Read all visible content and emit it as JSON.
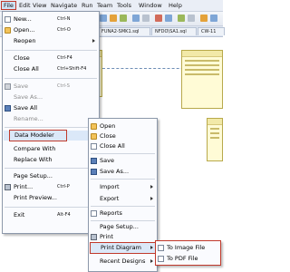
{
  "menubar": {
    "items": [
      "File",
      "Edit",
      "View",
      "Navigate",
      "Run",
      "Team",
      "Tools",
      "Window",
      "Help"
    ]
  },
  "tabs": [
    "FUNA2-SMK1.sql",
    "NFDO\\SA1.sql",
    "CW-11"
  ],
  "background": {
    "entity_fields_a": [
      "IDPR",
      "PRACTIC",
      "LDS"
    ],
    "entity_fields_b": [
      "OWNERUSERNAME",
      "OWNERTYPE",
      "RECORDSTATUS"
    ]
  },
  "file_menu": {
    "items": [
      {
        "label": "New...",
        "shortcut": "Ctrl-N",
        "icon": "new-icon"
      },
      {
        "label": "Open...",
        "shortcut": "Ctrl-O",
        "icon": "open-folder-icon"
      },
      {
        "label": "Reopen",
        "shortcut": "",
        "submenu": true
      },
      {
        "label": "Close",
        "shortcut": "Ctrl-F4"
      },
      {
        "label": "Close All",
        "shortcut": "Ctrl+Shift-F4"
      },
      {
        "label": "Save",
        "shortcut": "Ctrl-S",
        "disabled": true,
        "icon": "save-icon"
      },
      {
        "label": "Save As...",
        "disabled": true
      },
      {
        "label": "Save All",
        "icon": "save-all-icon"
      },
      {
        "label": "Rename...",
        "disabled": true
      },
      {
        "label": "Data Modeler",
        "submenu": true,
        "highlighted": true
      },
      {
        "label": "Compare With",
        "submenu": true
      },
      {
        "label": "Replace With",
        "submenu": true
      },
      {
        "label": "Page Setup..."
      },
      {
        "label": "Print...",
        "shortcut": "Ctrl-P",
        "icon": "print-icon"
      },
      {
        "label": "Print Preview..."
      },
      {
        "label": "Exit",
        "shortcut": "Alt-F4"
      }
    ]
  },
  "data_modeler_menu": {
    "items": [
      {
        "label": "Open",
        "icon": "open-icon"
      },
      {
        "label": "Close",
        "icon": "close-folder-icon"
      },
      {
        "label": "Close All"
      },
      {
        "label": "Save",
        "icon": "save-icon"
      },
      {
        "label": "Save As...",
        "icon": "save-as-icon"
      },
      {
        "label": "Import",
        "submenu": true
      },
      {
        "label": "Export",
        "submenu": true
      },
      {
        "label": "Reports",
        "icon": "reports-icon"
      },
      {
        "label": "Page Setup..."
      },
      {
        "label": "Print",
        "icon": "print-icon"
      },
      {
        "label": "Print Diagram",
        "submenu": true,
        "highlighted": true
      },
      {
        "label": "Recent Designs",
        "submenu": true
      }
    ]
  },
  "print_diagram_menu": {
    "items": [
      {
        "label": "To Image File",
        "icon": "image-file-icon"
      },
      {
        "label": "To PDF File",
        "icon": "pdf-file-icon"
      }
    ]
  },
  "colors": {
    "highlight": "#dbe8f8",
    "callout_border": "#c0392b",
    "menu_bg": "#fafbfe"
  }
}
